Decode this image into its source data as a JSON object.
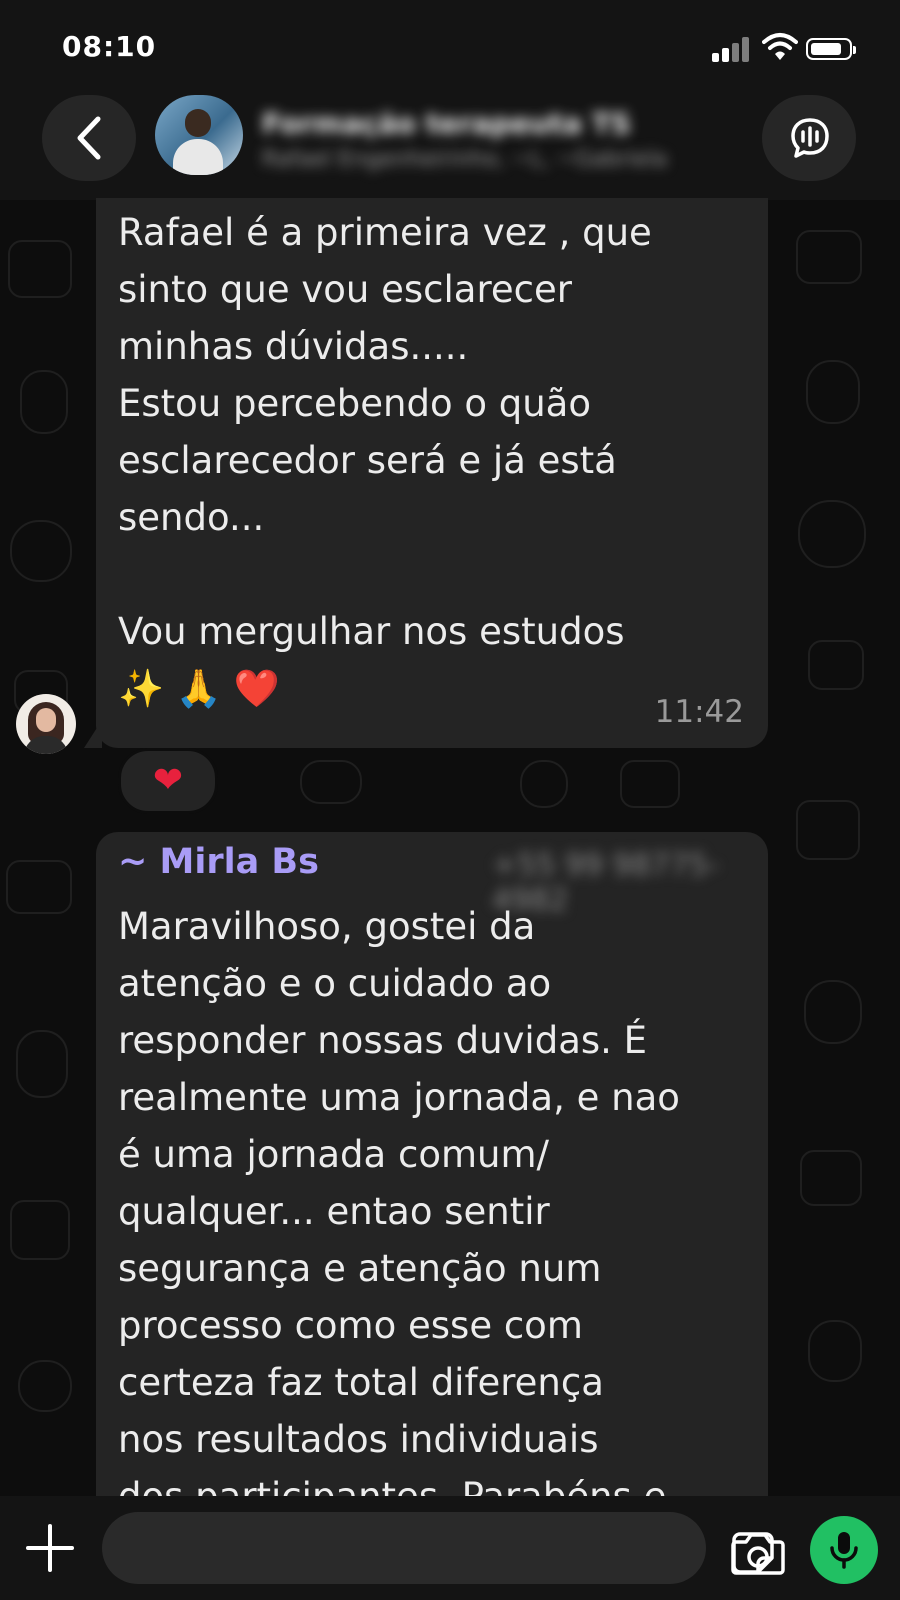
{
  "status_bar": {
    "time": "08:10",
    "icons": [
      "cellular-signal-icon",
      "wifi-icon",
      "battery-icon"
    ]
  },
  "header": {
    "group_name": "Formação terapeuta TS",
    "group_subtitle": "Rafael Engenheirinho, ~L, ~Gabriela",
    "back_icon": "chevron-left-icon",
    "call_icon": "group-call-icon"
  },
  "messages": [
    {
      "text": "Rafael é a primeira vez , que\nsinto que vou esclarecer\nminhas dúvidas.....\nEstou percebendo o quão\nesclarecedor será e já está\nsendo...\n\nVou mergulhar nos estudos\n✨ 🙏 ❤️",
      "time": "11:42",
      "reaction": "❤"
    },
    {
      "sender": "~ Mirla Bs",
      "phone": "+55 99 98775-4982",
      "text": "Maravilhoso, gostei da\natenção e o cuidado ao\nresponder nossas duvidas. É\nrealmente uma jornada, e nao\né uma jornada comum/\nqualquer... entao sentir\nsegurança e atenção num\nprocesso como esse com\ncerteza faz total diferença\nnos resultados individuais\ndos participantes. Parabéns e"
    }
  ],
  "composer": {
    "input_placeholder": "",
    "icons": [
      "plus-icon",
      "sticker-icon",
      "camera-icon",
      "microphone-icon"
    ]
  },
  "colors": {
    "background": "#0d0d0d",
    "bubble": "#242424",
    "sender_name": "#a99cf6",
    "mic_button": "#21c063",
    "reaction_heart": "#e8213d"
  }
}
